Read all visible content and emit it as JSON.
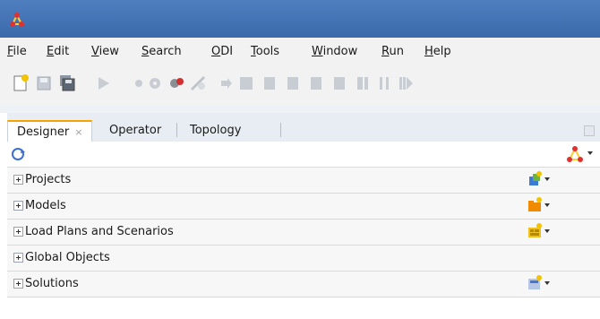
{
  "menu": {
    "file": {
      "u": "F",
      "rest": "ile"
    },
    "edit": {
      "u": "E",
      "rest": "dit"
    },
    "view": {
      "u": "V",
      "rest": "iew"
    },
    "search": {
      "u": "S",
      "rest": "earch"
    },
    "odi": {
      "u": "O",
      "rest": "DI"
    },
    "tools": {
      "u": "T",
      "rest": "ools"
    },
    "window": {
      "u": "W",
      "rest": "indow"
    },
    "run": {
      "u": "R",
      "rest": "un"
    },
    "help": {
      "u": "H",
      "rest": "elp"
    }
  },
  "tabs": {
    "designer": "Designer",
    "designer_close": "×",
    "operator": "Operator",
    "topology": "Topology"
  },
  "tree": [
    {
      "label": "Projects",
      "icon": "projects-icon"
    },
    {
      "label": "Models",
      "icon": "models-icon"
    },
    {
      "label": "Load Plans and Scenarios",
      "icon": "scenarios-icon"
    },
    {
      "label": "Global Objects",
      "icon": ""
    },
    {
      "label": "Solutions",
      "icon": "solutions-icon"
    }
  ],
  "colors": {
    "titlebar": "#3a6aab",
    "active_tab_accent": "#f5a300",
    "menubar": "#f2f2f2"
  }
}
